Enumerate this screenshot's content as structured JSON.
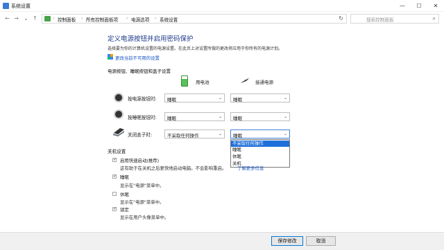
{
  "window": {
    "title": "系统设置",
    "min": "—",
    "max": "☐",
    "close": "✕"
  },
  "addressbar": {
    "crumbs": [
      "控制面板",
      "所有控制面板项",
      "电源选项",
      "系统设置"
    ],
    "search_placeholder": "搜索控制面板"
  },
  "page": {
    "heading": "定义电源按钮并启用密码保护",
    "description": "选择要为你的计算机设置的电源设置。在此页上对设置所做的更改将应用于你所有的电源计划。",
    "unavailable_link": "更改当前不可用的设置",
    "section_power": "电源按钮、睡眠按钮和盖子设置",
    "col_battery": "用电池",
    "col_plugged": "接通电源"
  },
  "rows": [
    {
      "label": "按电源按钮时:",
      "battery": "睡眠",
      "plugged": "睡眠"
    },
    {
      "label": "按睡眠按钮时:",
      "battery": "睡眠",
      "plugged": "睡眠"
    },
    {
      "label": "关闭盖子时:",
      "battery": "不采取任何操作",
      "plugged": "睡眠"
    }
  ],
  "dropdown_options": [
    "不采取任何操作",
    "睡眠",
    "休眠",
    "关机"
  ],
  "shutdown": {
    "section": "关机设置",
    "items": [
      {
        "title": "启用快速启动(推荐)",
        "desc": "这有助于在关机之后更快地启动电脑。不会影响重启。",
        "link": "了解更多信息",
        "checked": true
      },
      {
        "title": "睡眠",
        "desc": "显示在\"电源\"菜单中。",
        "checked": true
      },
      {
        "title": "休眠",
        "desc": "显示在\"电源\"菜单中。",
        "checked": false
      },
      {
        "title": "锁定",
        "desc": "显示在用户头像菜单中。",
        "checked": true
      }
    ]
  },
  "footer": {
    "save": "保存修改",
    "cancel": "取消"
  }
}
